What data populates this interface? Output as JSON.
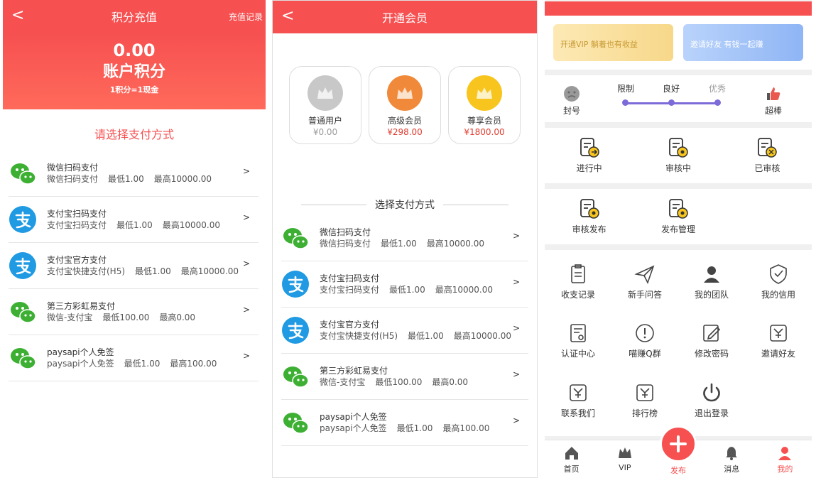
{
  "screen1": {
    "title": "积分充值",
    "back": "<",
    "record": "充值记录",
    "balance": "0.00",
    "balance_label": "账户积分",
    "rate": "1积分=1现金",
    "section_title": "请选择支付方式",
    "payments": [
      {
        "name": "微信扫码支付",
        "desc": "微信扫码支付",
        "min": "最低1.00",
        "max": "最高10000.00",
        "icon": "wechat-icon"
      },
      {
        "name": "支付宝扫码支付",
        "desc": "支付宝扫码支付",
        "min": "最低1.00",
        "max": "最高10000.00",
        "icon": "alipay-icon"
      },
      {
        "name": "支付宝官方支付",
        "desc": "支付宝快捷支付(H5)",
        "min": "最低1.00",
        "max": "最高10000.00",
        "icon": "alipay-icon"
      },
      {
        "name": "第三方彩虹易支付",
        "desc": "微信-支付宝",
        "min": "最低100.00",
        "max": "最高0.00",
        "icon": "wechat-icon"
      },
      {
        "name": "paysapi个人免签",
        "desc": "paysapi个人免签",
        "min": "最低1.00",
        "max": "最高100.00",
        "icon": "wechat-icon"
      }
    ],
    "chevron": ">"
  },
  "screen2": {
    "title": "开通会员",
    "back": "<",
    "plans": [
      {
        "name": "普通用户",
        "price": "¥0.00",
        "color": "#c8c8c8",
        "price_color": "#999999"
      },
      {
        "name": "高级会员",
        "price": "¥298.00",
        "color": "#f08a3a",
        "price_color": "#e23b2e"
      },
      {
        "name": "尊享会员",
        "price": "¥1800.00",
        "color": "#f7c51e",
        "price_color": "#e23b2e"
      }
    ],
    "section_title": "选择支付方式",
    "payments": [
      {
        "name": "微信扫码支付",
        "desc": "微信扫码支付",
        "min": "最低1.00",
        "max": "最高10000.00",
        "icon": "wechat-icon"
      },
      {
        "name": "支付宝扫码支付",
        "desc": "支付宝扫码支付",
        "min": "最低1.00",
        "max": "最高10000.00",
        "icon": "alipay-icon"
      },
      {
        "name": "支付宝官方支付",
        "desc": "支付宝快捷支付(H5)",
        "min": "最低1.00",
        "max": "最高10000.00",
        "icon": "alipay-icon"
      },
      {
        "name": "第三方彩虹易支付",
        "desc": "微信-支付宝",
        "min": "最低100.00",
        "max": "最高0.00",
        "icon": "wechat-icon"
      },
      {
        "name": "paysapi个人免签",
        "desc": "paysapi个人免签",
        "min": "最低1.00",
        "max": "最高100.00",
        "icon": "wechat-icon"
      }
    ],
    "chevron": ">"
  },
  "screen3": {
    "banners": {
      "vip": "开通VIP 躺着也有收益",
      "invite": "邀请好友 有钱一起赚"
    },
    "credit": {
      "left": "封号",
      "right": "超棒",
      "levels": [
        "限制",
        "良好",
        "优秀"
      ]
    },
    "review_row1": [
      "进行中",
      "审核中",
      "已审核"
    ],
    "review_row2": [
      "审核发布",
      "发布管理"
    ],
    "menu": [
      "收支记录",
      "新手问答",
      "我的团队",
      "我的信用",
      "认证中心",
      "喵赚Q群",
      "修改密码",
      "邀请好友",
      "联系我们",
      "排行榜",
      "退出登录"
    ],
    "tabs": [
      "首页",
      "VIP",
      "发布",
      "消息",
      "我的"
    ],
    "accent": "#f65051"
  }
}
